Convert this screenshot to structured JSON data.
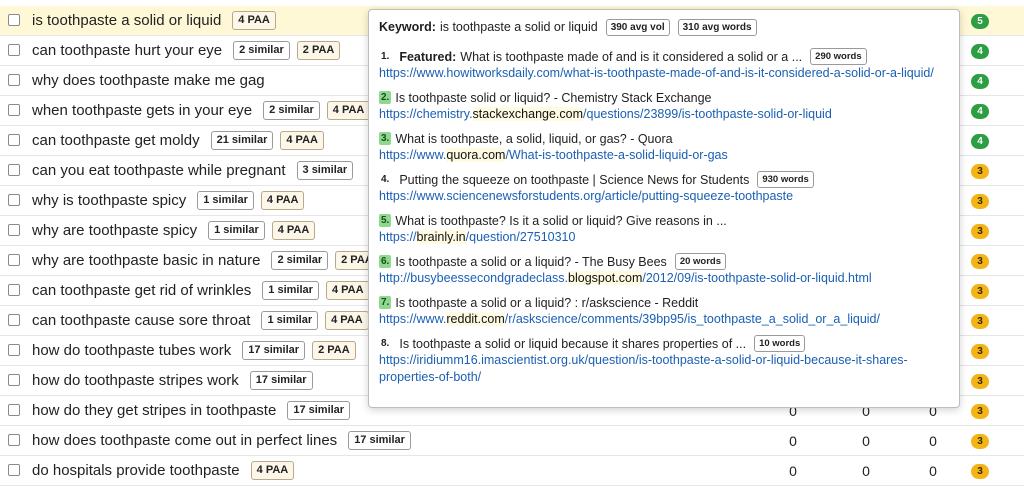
{
  "keywords": [
    {
      "text": "is toothpaste a solid or liquid",
      "chips": [
        "4 PAA"
      ],
      "score": "5",
      "level": "green",
      "vals": [
        "",
        "",
        ""
      ]
    },
    {
      "text": "can toothpaste hurt your eye",
      "chips": [
        "2 similar",
        "2 PAA"
      ],
      "score": "4",
      "level": "green",
      "vals": [
        "",
        "",
        ""
      ]
    },
    {
      "text": "why does toothpaste make me gag",
      "chips": [],
      "score": "4",
      "level": "green",
      "vals": [
        "",
        "",
        ""
      ]
    },
    {
      "text": "when toothpaste gets in your eye",
      "chips": [
        "2 similar",
        "4 PAA"
      ],
      "score": "4",
      "level": "green",
      "vals": [
        "",
        "",
        ""
      ]
    },
    {
      "text": "can toothpaste get moldy",
      "chips": [
        "21 similar",
        "4 PAA"
      ],
      "score": "4",
      "level": "green",
      "vals": [
        "",
        "",
        ""
      ]
    },
    {
      "text": "can you eat toothpaste while pregnant",
      "chips": [
        "3 similar"
      ],
      "score": "3",
      "level": "yellow",
      "vals": [
        "",
        "",
        ""
      ]
    },
    {
      "text": "why is toothpaste spicy",
      "chips": [
        "1 similar",
        "4 PAA"
      ],
      "score": "3",
      "level": "yellow",
      "vals": [
        "",
        "",
        ""
      ]
    },
    {
      "text": "why are toothpaste spicy",
      "chips": [
        "1 similar",
        "4 PAA"
      ],
      "score": "3",
      "level": "yellow",
      "vals": [
        "",
        "",
        ""
      ]
    },
    {
      "text": "why are toothpaste basic in nature",
      "chips": [
        "2 similar",
        "2 PAA"
      ],
      "score": "3",
      "level": "yellow",
      "vals": [
        "",
        "",
        ""
      ]
    },
    {
      "text": "can toothpaste get rid of wrinkles",
      "chips": [
        "1 similar",
        "4 PAA"
      ],
      "score": "3",
      "level": "yellow",
      "vals": [
        "",
        "",
        ""
      ]
    },
    {
      "text": "can toothpaste cause sore throat",
      "chips": [
        "1 similar",
        "4 PAA"
      ],
      "score": "3",
      "level": "yellow",
      "vals": [
        "",
        "",
        ""
      ]
    },
    {
      "text": "how do toothpaste tubes work",
      "chips": [
        "17 similar",
        "2 PAA"
      ],
      "score": "3",
      "level": "yellow",
      "vals": [
        "",
        "",
        ""
      ]
    },
    {
      "text": "how do toothpaste stripes work",
      "chips": [
        "17 similar"
      ],
      "score": "3",
      "level": "yellow",
      "vals": [
        "",
        "",
        ""
      ]
    },
    {
      "text": "how do they get stripes in toothpaste",
      "chips": [
        "17 similar"
      ],
      "score": "3",
      "level": "yellow",
      "vals": [
        "0",
        "0",
        "0"
      ]
    },
    {
      "text": "how does toothpaste come out in perfect lines",
      "chips": [
        "17 similar"
      ],
      "score": "3",
      "level": "yellow",
      "vals": [
        "0",
        "0",
        "0"
      ]
    },
    {
      "text": "do hospitals provide toothpaste",
      "chips": [
        "4 PAA"
      ],
      "score": "3",
      "level": "yellow",
      "vals": [
        "0",
        "0",
        "0"
      ]
    }
  ],
  "popup": {
    "keyword_label": "Keyword:",
    "keyword": "is toothpaste a solid or liquid",
    "avg_vol": "390 avg vol",
    "avg_words": "310 avg words",
    "results": [
      {
        "rank": "1.",
        "hl": false,
        "featured": "Featured:",
        "title": "What is toothpaste made of and is it considered a solid or a ...",
        "words": "290 words",
        "url_pre": "https://www.howitworksdaily.com/what-is-toothpaste-made-of-and-is-it-considered-a-solid-or-a-liquid/",
        "domain": "",
        "url_post": ""
      },
      {
        "rank": "2.",
        "hl": true,
        "featured": "",
        "title": "Is toothpaste solid or liquid? - Chemistry Stack Exchange",
        "words": "",
        "url_pre": "https://chemistry.",
        "domain": "stackexchange.com",
        "url_post": "/questions/23899/is-toothpaste-solid-or-liquid"
      },
      {
        "rank": "3.",
        "hl": true,
        "featured": "",
        "title": "What is toothpaste, a solid, liquid, or gas? - Quora",
        "words": "",
        "url_pre": "https://www.",
        "domain": "quora.com",
        "url_post": "/What-is-toothpaste-a-solid-liquid-or-gas"
      },
      {
        "rank": "4.",
        "hl": false,
        "featured": "",
        "title": "Putting the squeeze on toothpaste | Science News for Students",
        "words": "930 words",
        "url_pre": "https://www.sciencenewsforstudents.org/article/putting-squeeze-toothpaste",
        "domain": "",
        "url_post": ""
      },
      {
        "rank": "5.",
        "hl": true,
        "featured": "",
        "title": "What is toothpaste? Is it a solid or liquid? Give reasons in ...",
        "words": "",
        "url_pre": "https://",
        "domain": "brainly.in",
        "url_post": "/question/27510310"
      },
      {
        "rank": "6.",
        "hl": true,
        "featured": "",
        "title": "Is toothpaste a solid or a liquid? - The Busy Bees",
        "words": "20 words",
        "url_pre": "http://busybeessecondgradeclass.",
        "domain": "blogspot.com",
        "url_post": "/2012/09/is-toothpaste-solid-or-liquid.html"
      },
      {
        "rank": "7.",
        "hl": true,
        "featured": "",
        "title": "Is toothpaste a solid or a liquid? : r/askscience - Reddit",
        "words": "",
        "url_pre": "https://www.",
        "domain": "reddit.com",
        "url_post": "/r/askscience/comments/39bp95/is_toothpaste_a_solid_or_a_liquid/"
      },
      {
        "rank": "8.",
        "hl": false,
        "featured": "",
        "title": "Is toothpaste a solid or liquid because it shares properties of ...",
        "words": "10 words",
        "url_pre": "https://iridiumm16.imascientist.org.uk/question/is-toothpaste-a-solid-or-liquid-because-it-shares-properties-of-both/",
        "domain": "",
        "url_post": ""
      }
    ]
  }
}
